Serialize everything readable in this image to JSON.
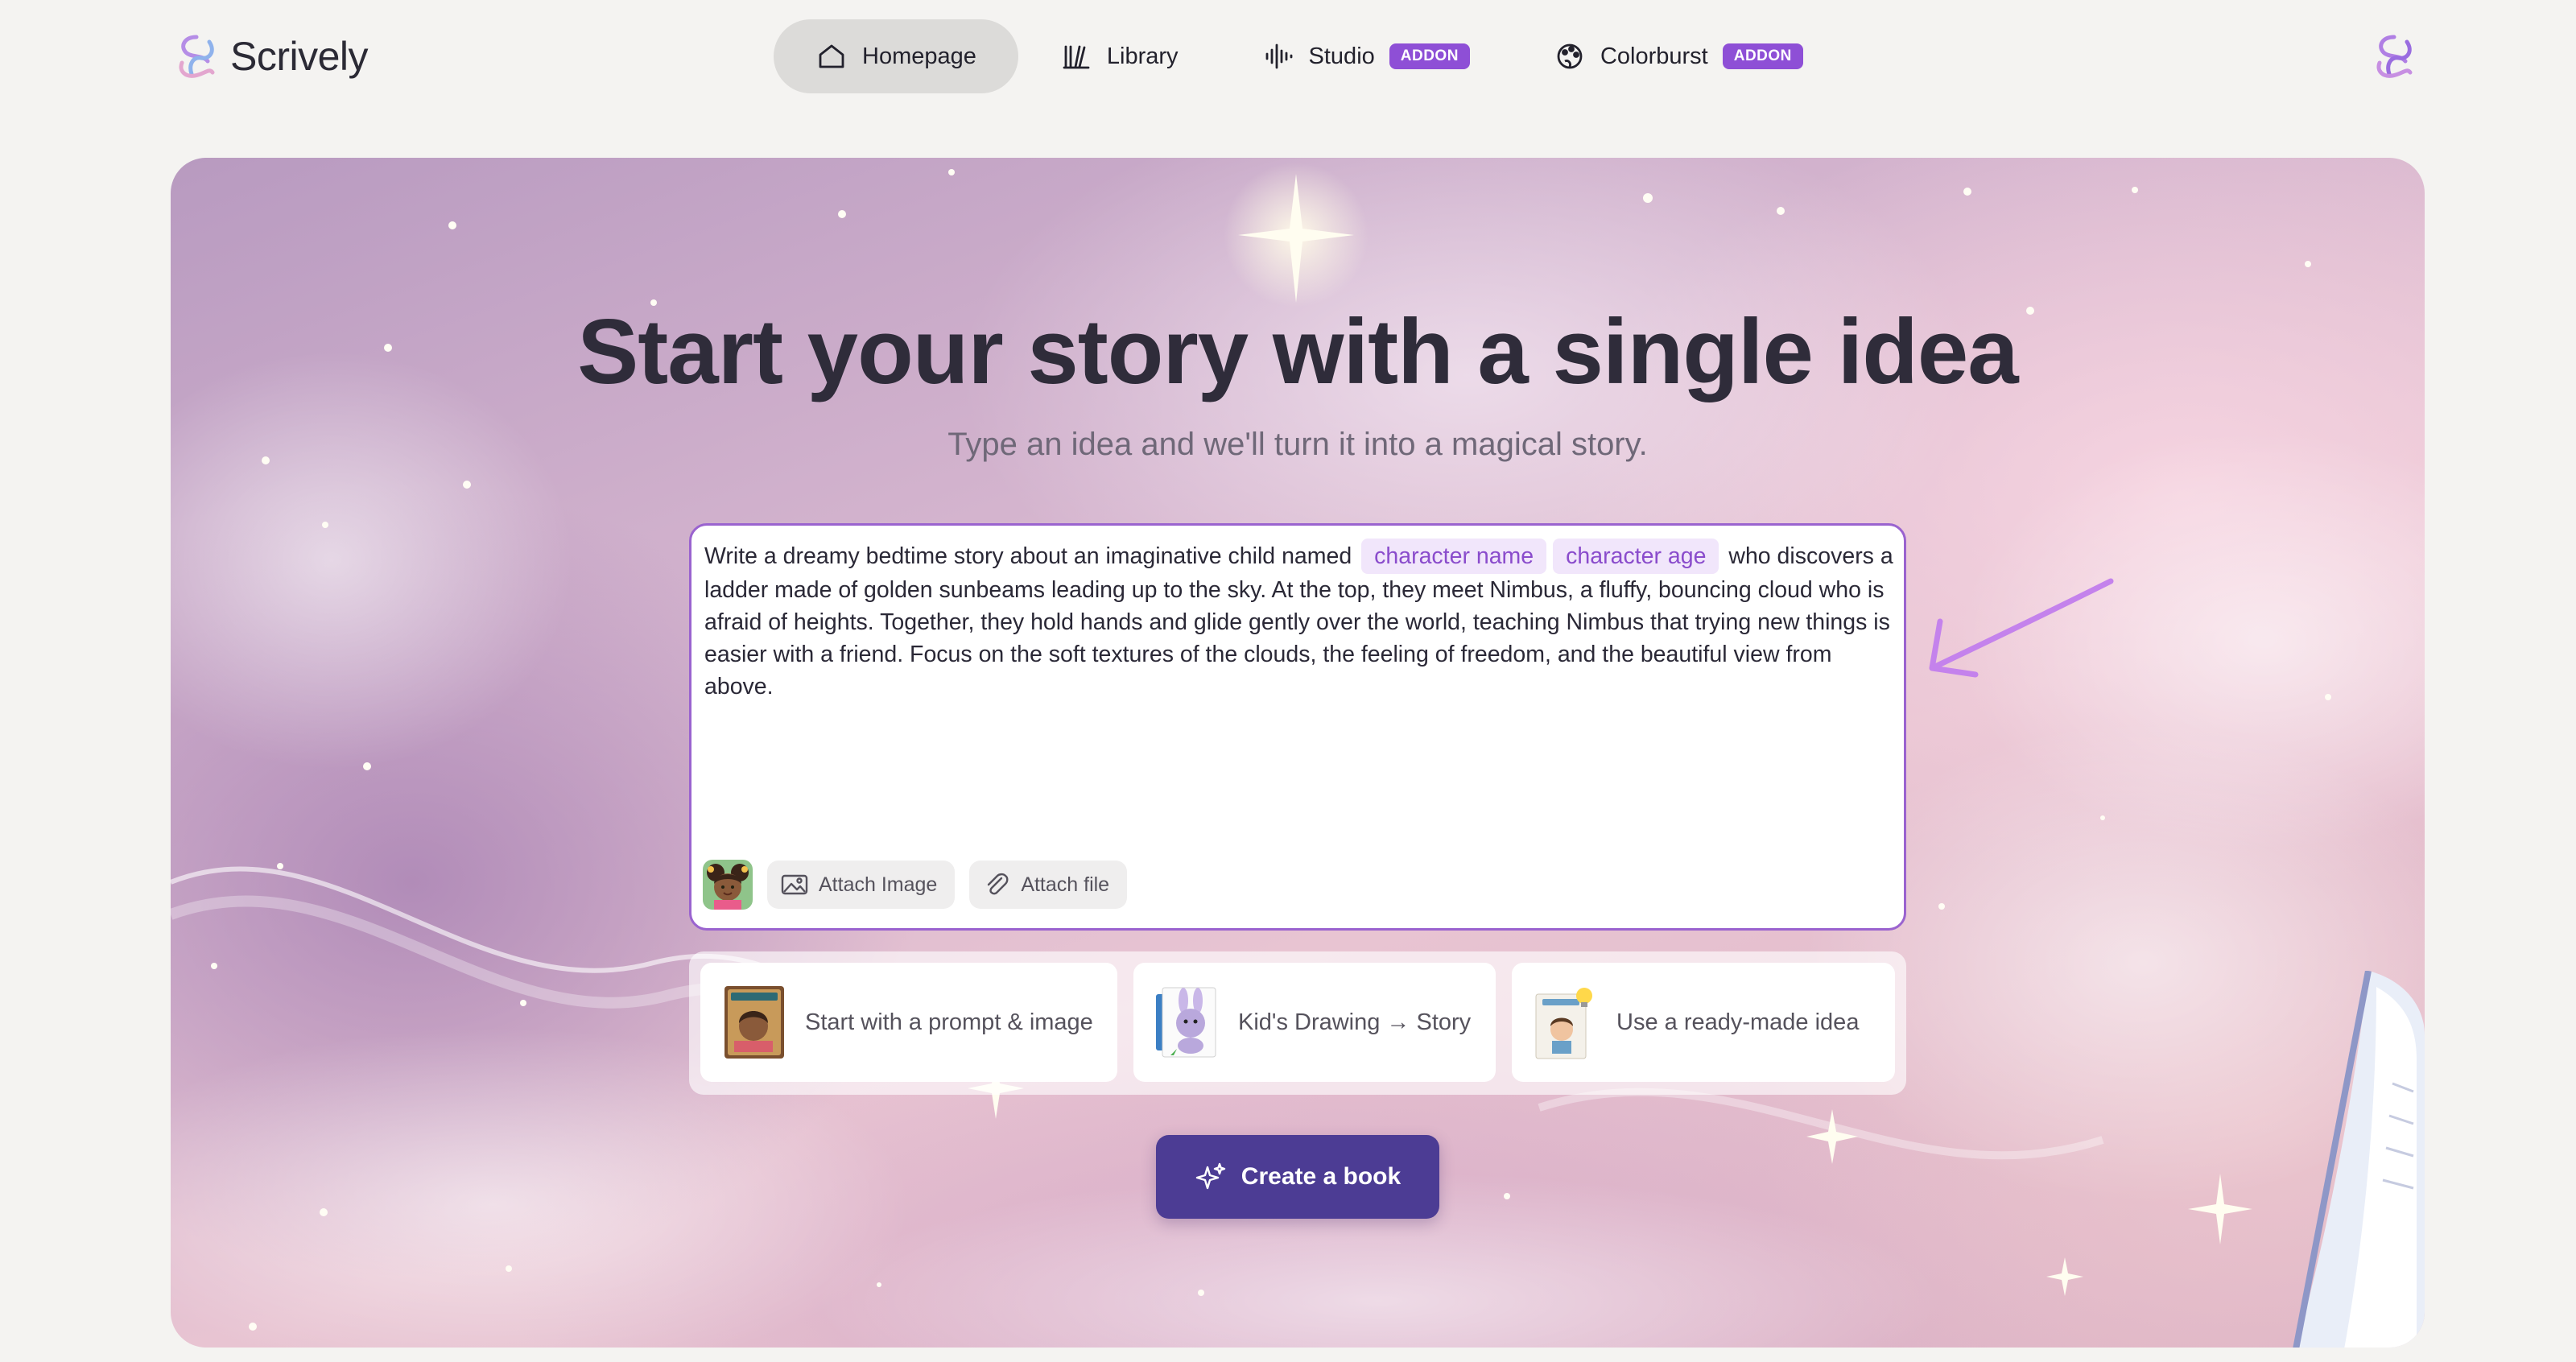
{
  "brand": {
    "name": "Scrively",
    "logo_icon": "scrively-swirl-icon"
  },
  "nav": [
    {
      "label": "Homepage",
      "icon": "home-icon",
      "active": true,
      "badge": ""
    },
    {
      "label": "Library",
      "icon": "books-icon",
      "active": false,
      "badge": ""
    },
    {
      "label": "Studio",
      "icon": "audio-wave-icon",
      "active": false,
      "badge": "ADDON"
    },
    {
      "label": "Colorburst",
      "icon": "palette-icon",
      "active": false,
      "badge": "ADDON"
    }
  ],
  "hero": {
    "title": "Start your story with a single idea",
    "subtitle": "Type an idea and we'll turn it into a magical story."
  },
  "prompt": {
    "text_before": "Write a dreamy bedtime story about an imaginative child named",
    "chip_name": "character name",
    "chip_age": "character age",
    "text_after": "who discovers a ladder made of golden sunbeams leading up to the sky. At the top, they meet Nimbus, a fluffy, bouncing cloud who is afraid of heights. Together, they hold hands and glide gently over the world, teaching Nimbus that trying new things is easier with a friend. Focus on the soft textures of the clouds, the feeling of freedom, and the beautiful view from above.",
    "attach_image_label": "Attach Image",
    "attach_file_label": "Attach file"
  },
  "options": [
    {
      "label": "Start with a prompt & image",
      "icon": "book-cover-thumbnail"
    },
    {
      "label": "Kid's Drawing → Story",
      "icon": "bunny-drawing-thumbnail"
    },
    {
      "label": "Use a ready-made idea",
      "icon": "idea-book-thumbnail"
    }
  ],
  "create_button": {
    "label": "Create a book",
    "icon": "sparkles-icon"
  },
  "colors": {
    "accent": "#8e4fd6",
    "create_button": "#4c3c94",
    "chip_bg": "#f1e6fb",
    "chip_text": "#8a4ccc",
    "active_nav_bg": "#dcdbd9"
  }
}
